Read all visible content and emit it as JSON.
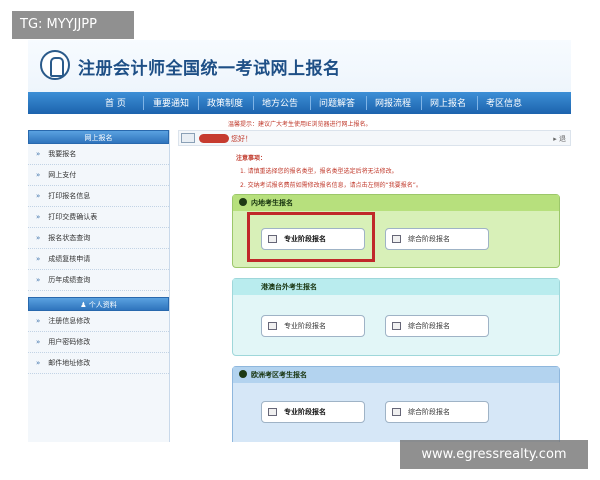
{
  "watermark": {
    "top_left": "TG: MYYJJPP",
    "bottom_right": "www.egressrealty.com"
  },
  "header": {
    "title": "注册会计师全国统一考试网上报名",
    "logo_icon": "cicpa-logo-icon"
  },
  "nav": {
    "items": [
      "首 页",
      "重要通知",
      "政策制度",
      "地方公告",
      "问题解答",
      "网报流程",
      "网上报名",
      "考区信息"
    ]
  },
  "notice_line": "温馨提示：建议广大考生使用IE浏览器进行网上报名。",
  "sidebar": {
    "section1_title": "网上报名",
    "section1_items": [
      "我要报名",
      "网上支付",
      "打印报名信息",
      "打印交费确认表",
      "报名状态查询",
      "成绩复核申请",
      "历年成绩查询"
    ],
    "section2_title": "个人资料",
    "section2_items": [
      "注册信息修改",
      "用户密码修改",
      "邮件地址修改"
    ]
  },
  "greeting": {
    "text": "您好！",
    "right_text": "▸ 退"
  },
  "tips": {
    "title": "注意事项：",
    "items": [
      "1. 请慎重选择您的报名类型，报名类型选定后将无法修改。",
      "2. 交纳考试报名费前如需修改报名信息，请点击左侧的“我要报名”。"
    ]
  },
  "panels": [
    {
      "title": "内地考生报名",
      "btn1": "专业阶段报名",
      "btn2": "综合阶段报名",
      "color": "#d8f0b8",
      "head_color": "#b7e07d"
    },
    {
      "title": "港澳台外考生报名",
      "btn1": "专业阶段报名",
      "btn2": "综合阶段报名",
      "color": "#e2f6f7",
      "head_color": "#b9ecee"
    },
    {
      "title": "欧洲考区考生报名",
      "btn1": "专业阶段报名",
      "btn2": "综合阶段报名",
      "color": "#d6e7f7",
      "head_color": "#b3d3ef"
    }
  ],
  "colors": {
    "nav_blue": "#1c63ad",
    "highlight_red": "#c0282a",
    "tip_red": "#c0392b"
  }
}
